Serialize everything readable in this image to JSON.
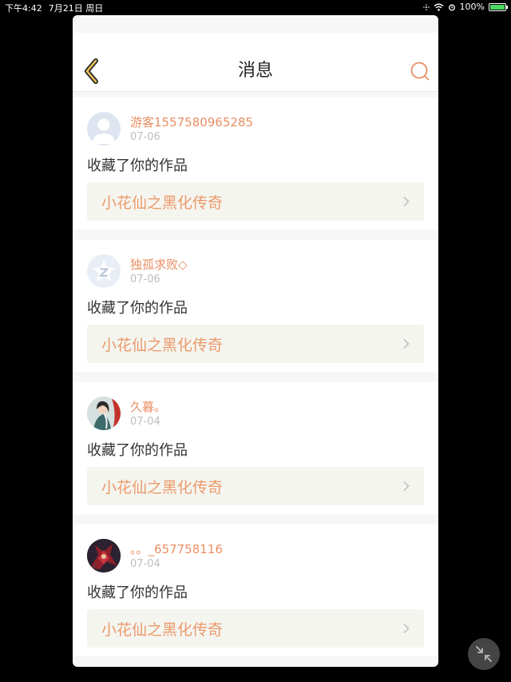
{
  "status_bar": {
    "time": "下午4:42",
    "date": "7月21日 周日",
    "battery": "100%",
    "battery_level": 1.0
  },
  "nav": {
    "title": "消息",
    "back_icon": "chevron-left-icon",
    "search_icon": "search-icon"
  },
  "messages": [
    {
      "username": "游客1557580965285",
      "date": "07-06",
      "action": "收藏了你的作品",
      "work_title": "小花仙之黑化传奇",
      "avatar": "default-avatar-icon"
    },
    {
      "username": "独孤求败◇",
      "date": "07-06",
      "action": "收藏了你的作品",
      "work_title": "小花仙之黑化传奇",
      "avatar": "qzone-avatar-icon"
    },
    {
      "username": "久暮。",
      "date": "07-04",
      "action": "收藏了你的作品",
      "work_title": "小花仙之黑化传奇",
      "avatar": "photo-avatar"
    },
    {
      "username": "。。_657758116",
      "date": "07-04",
      "action": "收藏了你的作品",
      "work_title": "小花仙之黑化传奇",
      "avatar": "photo-avatar"
    }
  ],
  "colors": {
    "accent": "#e98f64",
    "link_background": "#f5f5ef",
    "page_background": "#f7f7f7"
  },
  "floating_button_icon": "collapse-arrows-icon"
}
